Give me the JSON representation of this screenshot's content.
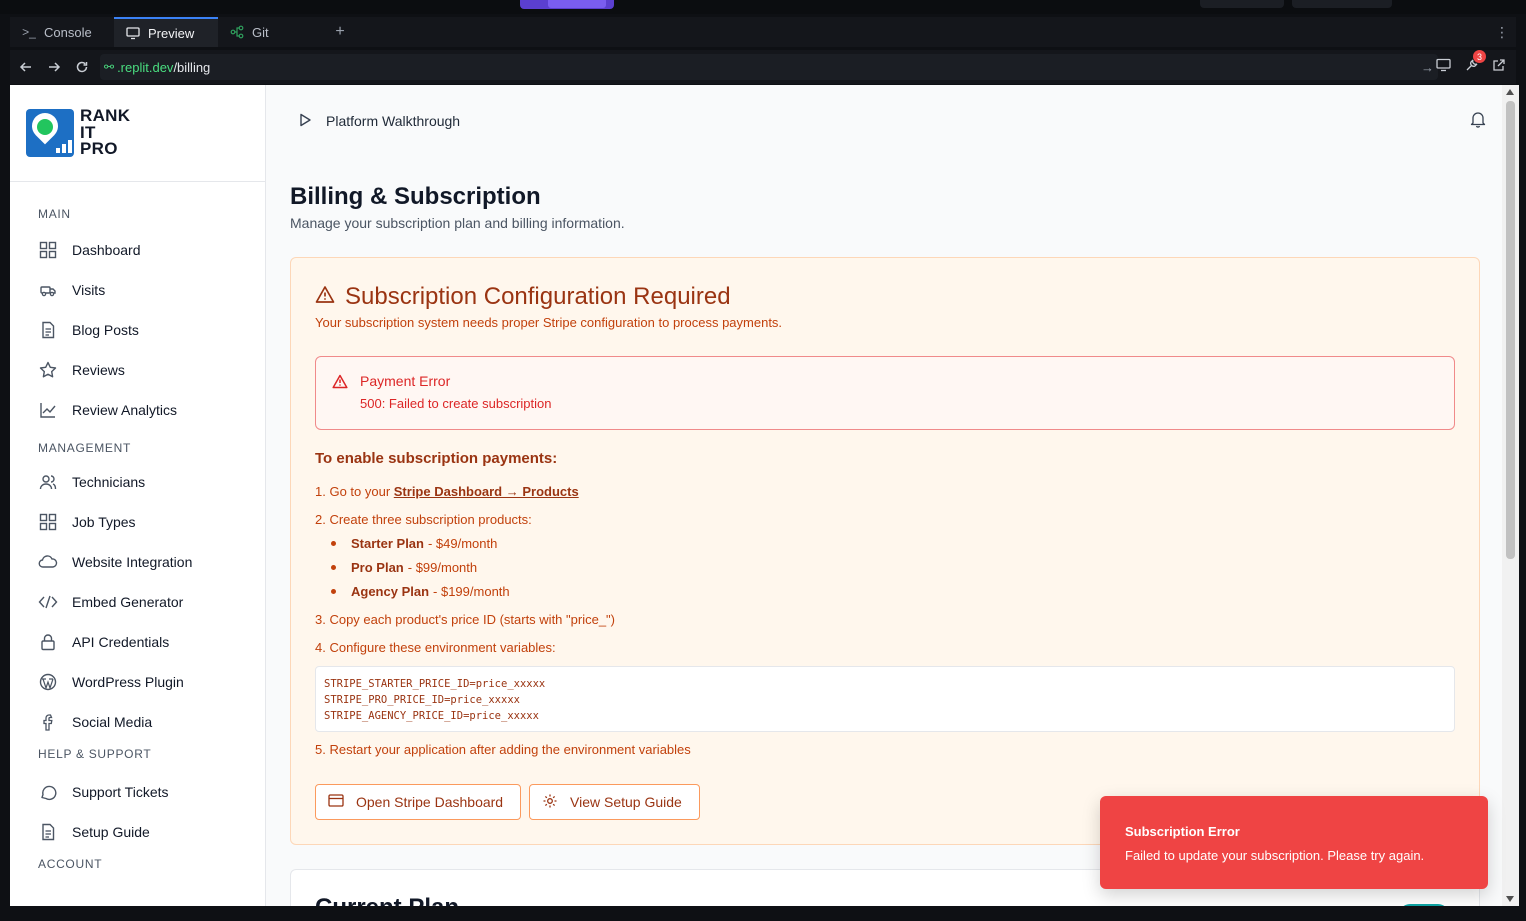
{
  "ide": {
    "tabs": [
      {
        "label": "Console"
      },
      {
        "label": "Preview"
      },
      {
        "label": "Git"
      }
    ],
    "url": {
      "domain": ".replit.dev",
      "path": "/billing"
    },
    "notification_count": "3"
  },
  "sidebar": {
    "brand": {
      "line1": "RANK",
      "line2": "IT",
      "line3": "PRO"
    },
    "sections": {
      "main": "MAIN",
      "management": "MANAGEMENT",
      "help": "HELP & SUPPORT",
      "account": "ACCOUNT"
    },
    "main_items": [
      {
        "label": "Dashboard",
        "icon": "dashboard-icon"
      },
      {
        "label": "Visits",
        "icon": "truck-icon"
      },
      {
        "label": "Blog Posts",
        "icon": "document-icon"
      },
      {
        "label": "Reviews",
        "icon": "star-icon"
      },
      {
        "label": "Review Analytics",
        "icon": "chart-line-icon"
      }
    ],
    "management_items": [
      {
        "label": "Technicians",
        "icon": "users-icon"
      },
      {
        "label": "Job Types",
        "icon": "grid-icon"
      },
      {
        "label": "Website Integration",
        "icon": "cloud-icon"
      },
      {
        "label": "Embed Generator",
        "icon": "code-icon"
      },
      {
        "label": "API Credentials",
        "icon": "lock-icon"
      },
      {
        "label": "WordPress Plugin",
        "icon": "wordpress-icon"
      },
      {
        "label": "Social Media",
        "icon": "facebook-icon"
      }
    ],
    "help_items": [
      {
        "label": "Support Tickets",
        "icon": "chat-icon"
      },
      {
        "label": "Setup Guide",
        "icon": "document-icon"
      }
    ]
  },
  "topbar": {
    "walkthrough": "Platform Walkthrough"
  },
  "page": {
    "title": "Billing & Subscription",
    "subtitle": "Manage your subscription plan and billing information."
  },
  "config": {
    "title": "Subscription Configuration Required",
    "description": "Your subscription system needs proper Stripe configuration to process payments.",
    "error_title": "Payment Error",
    "error_detail": "500: Failed to create subscription",
    "steps_title": "To enable subscription payments:",
    "step1_prefix": "1. Go to your ",
    "step1_link": "Stripe Dashboard → Products",
    "step2": "2. Create three subscription products:",
    "plans": [
      {
        "name": "Starter Plan",
        "price": "- $49/month"
      },
      {
        "name": "Pro Plan",
        "price": "- $99/month"
      },
      {
        "name": "Agency Plan",
        "price": "- $199/month"
      }
    ],
    "step3": "3. Copy each product's price ID (starts with \"price_\")",
    "step4": "4. Configure these environment variables:",
    "env_lines": [
      "STRIPE_STARTER_PRICE_ID=price_xxxxx",
      "STRIPE_PRO_PRICE_ID=price_xxxxx",
      "STRIPE_AGENCY_PRICE_ID=price_xxxxx"
    ],
    "step5": "5. Restart your application after adding the environment variables",
    "btn_stripe": "Open Stripe Dashboard",
    "btn_guide": "View Setup Guide"
  },
  "current_plan": {
    "title": "Current Plan"
  },
  "toast": {
    "title": "Subscription Error",
    "message": "Failed to update your subscription. Please try again."
  }
}
